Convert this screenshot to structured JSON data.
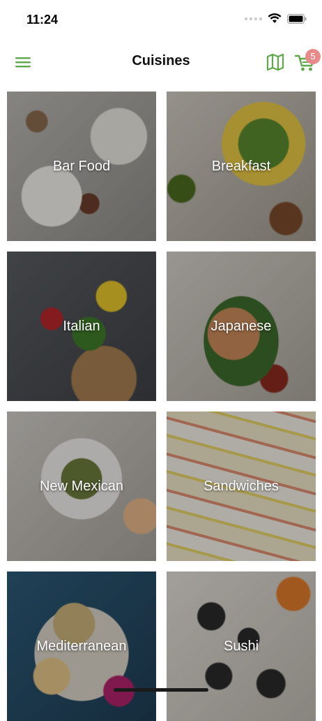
{
  "status_bar": {
    "time": "11:24"
  },
  "nav": {
    "title": "Cuisines",
    "cart_count": "5",
    "accent_color": "#5fa84a",
    "badge_color": "#e88a8a",
    "icons": [
      "menu-icon",
      "map-icon",
      "cart-icon"
    ]
  },
  "cuisines": [
    {
      "label": "Bar Food"
    },
    {
      "label": "Breakfast"
    },
    {
      "label": "Italian"
    },
    {
      "label": "Japanese"
    },
    {
      "label": "New Mexican"
    },
    {
      "label": "Sandwiches"
    },
    {
      "label": "Mediterranean"
    },
    {
      "label": "Sushi"
    }
  ]
}
